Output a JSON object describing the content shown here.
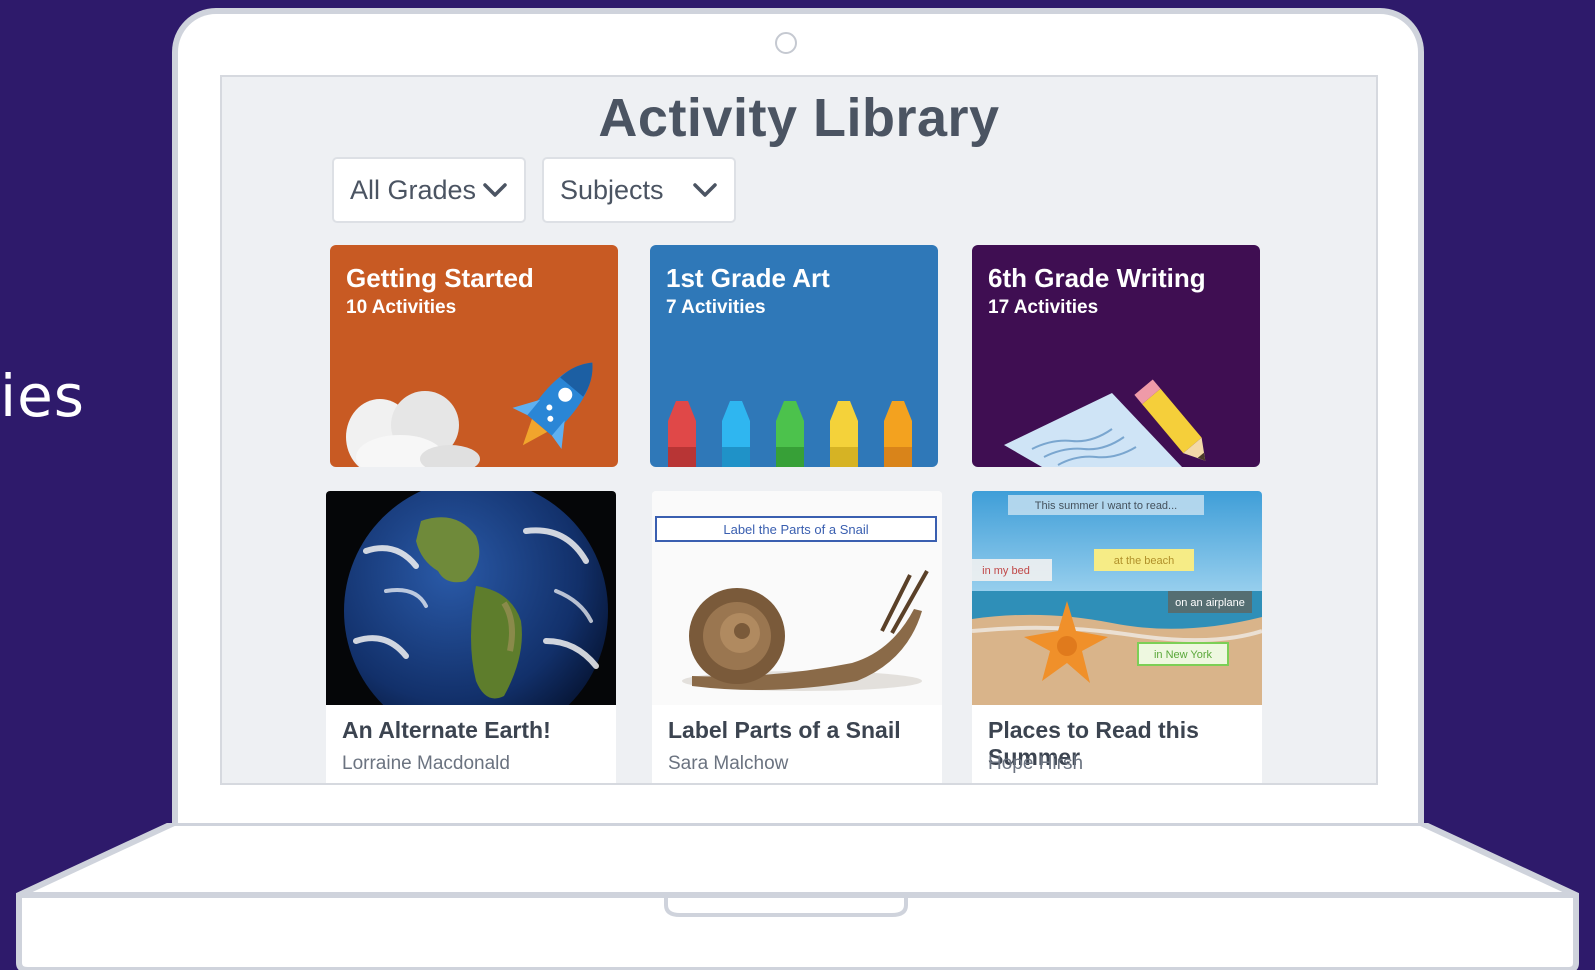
{
  "side_caption": "ies",
  "page_title": "Activity Library",
  "filters": {
    "grades": {
      "label": "All Grades",
      "icon": "chevron-down-icon"
    },
    "subjects": {
      "label": "Subjects",
      "icon": "chevron-down-icon"
    }
  },
  "collections": [
    {
      "name": "Getting Started",
      "count": "10 Activities",
      "color": "#c85a23",
      "icon": "rocket-icon"
    },
    {
      "name": "1st Grade Art",
      "count": "7 Activities",
      "color": "#2f78b8",
      "icon": "crayons-icon"
    },
    {
      "name": "6th Grade Writing",
      "count": "17 Activities",
      "color": "#3f0e52",
      "icon": "pencil-paper-icon"
    }
  ],
  "activities": [
    {
      "title": "An Alternate Earth!",
      "author": "Lorraine Macdonald",
      "thumbnail": "earth-image"
    },
    {
      "title": "Label Parts of a Snail",
      "author": "Sara Malchow",
      "thumbnail": "snail-image",
      "thumb_banner": "Label the Parts of a Snail"
    },
    {
      "title": "Places to Read this Summer",
      "author": "Hope Hirsh",
      "thumbnail": "beach-starfish-image",
      "thumb_labels": [
        "This summer I want to read...",
        "at the beach",
        "in my bed",
        "on an airplane",
        "in New York"
      ]
    }
  ],
  "colors": {
    "background": "#2e1a6b",
    "screen": "#eef0f3",
    "title": "#4b5462"
  }
}
